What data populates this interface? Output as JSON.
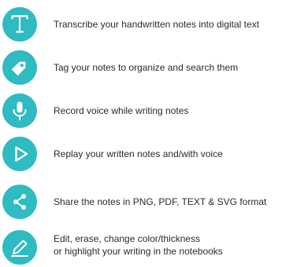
{
  "theme": {
    "accent": "#2ebbc1",
    "icon_glyph": "#ffffff",
    "text": "#2b2b2b"
  },
  "features": [
    {
      "icon": "text-t-icon",
      "text": "Transcribe your handwritten notes into digital text"
    },
    {
      "icon": "tag-icon",
      "text": "Tag your notes to organize and search them"
    },
    {
      "icon": "microphone-icon",
      "text": "Record voice while writing notes"
    },
    {
      "icon": "play-icon",
      "text": "Replay your written notes and/with voice"
    },
    {
      "icon": "share-icon",
      "text": "Share the notes in PNG, PDF, TEXT & SVG format"
    },
    {
      "icon": "pencil-edit-icon",
      "text_line1": "Edit, erase, change color/thickness",
      "text_line2": "or highlight your writing in the notebooks"
    }
  ]
}
